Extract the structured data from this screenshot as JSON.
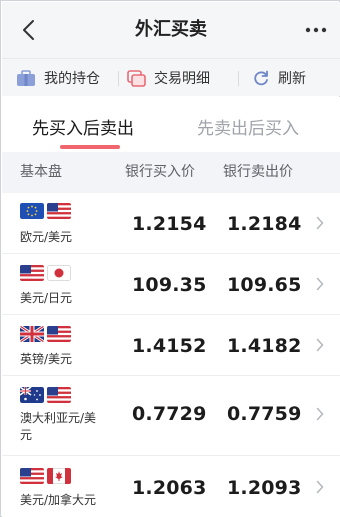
{
  "header": {
    "title": "外汇买卖",
    "back_icon": "chevron-left-icon",
    "more_icon": "more-dots-icon"
  },
  "toolbar": {
    "items": [
      {
        "label": "我的持仓",
        "icon": "portfolio-icon"
      },
      {
        "label": "交易明细",
        "icon": "records-icon"
      },
      {
        "label": "刷新",
        "icon": "refresh-icon"
      }
    ]
  },
  "tabs": [
    {
      "label": "先买入后卖出",
      "active": true
    },
    {
      "label": "先卖出后买入",
      "active": false
    }
  ],
  "table": {
    "columns": [
      "基本盘",
      "银行买入价",
      "银行卖出价"
    ],
    "rows": [
      {
        "pair": "欧元/美元",
        "flags": [
          "eu-flag-icon",
          "us-flag-icon"
        ],
        "buy": "1.2154",
        "sell": "1.2184"
      },
      {
        "pair": "美元/日元",
        "flags": [
          "us-flag-icon",
          "jp-flag-icon"
        ],
        "buy": "109.35",
        "sell": "109.65"
      },
      {
        "pair": "英镑/美元",
        "flags": [
          "uk-flag-icon",
          "us-flag-icon"
        ],
        "buy": "1.4152",
        "sell": "1.4182"
      },
      {
        "pair": "澳大利亚元/美元",
        "pair_line1": "澳大利亚元/美",
        "pair_line2": "元",
        "flags": [
          "au-flag-icon",
          "us-flag-icon"
        ],
        "buy": "0.7729",
        "sell": "0.7759"
      },
      {
        "pair": "美元/加拿大元",
        "flags": [
          "us-flag-icon",
          "ca-flag-icon"
        ],
        "buy": "1.2063",
        "sell": "1.2093"
      }
    ]
  },
  "colors": {
    "accent": "#f0656e",
    "toolbar_icon": "#6f86c7",
    "background": "#f5f6f8"
  }
}
